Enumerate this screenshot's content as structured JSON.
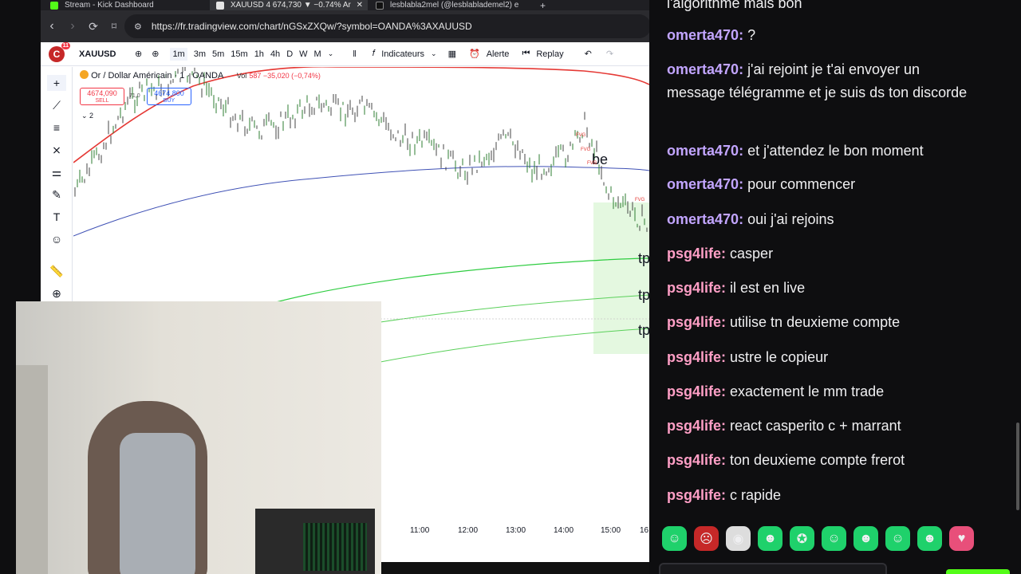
{
  "browser": {
    "tabs": [
      {
        "label": "Stream - Kick Dashboard",
        "icon": "kick-icon"
      },
      {
        "label": "XAUUSD 4 674,730 ▼ −0.74% Ar",
        "icon": "tradingview-icon",
        "close": "✕"
      },
      {
        "label": "lesblabla2mel (@lesblablademel2) e",
        "icon": "tiktok-icon"
      }
    ],
    "new_tab": "+",
    "url": "https://fr.tradingview.com/chart/nGSxZXQw/?symbol=OANDA%3AXAUUSD"
  },
  "tradingview": {
    "avatar_letter": "C",
    "notif_count": "11",
    "symbol": "XAUUSD",
    "timeframes": [
      "1m",
      "3m",
      "5m",
      "15m",
      "1h",
      "4h",
      "D",
      "W",
      "M"
    ],
    "indicators_label": "Indicateurs",
    "alert_label": "Alerte",
    "replay_label": "Replay",
    "legend_title": "Or / Dollar Américain · 1 · OANDA",
    "legend_vol": "Vol",
    "legend_change": "587  −35,020 (−0,74%)",
    "sell_price": "4674,090",
    "sell_label": "SELL",
    "mid_label": "71,0",
    "buy_price": "4674,800",
    "buy_label": "BUY",
    "indicators_count": "2",
    "annotations": [
      "be",
      "tp",
      "tp",
      "tp"
    ],
    "fvg_labels": [
      "FVG",
      "FVG",
      "FVG",
      "FVG"
    ],
    "time_labels": [
      "11:00",
      "12:00",
      "13:00",
      "14:00",
      "15:00",
      "16"
    ]
  },
  "chat": {
    "top_partial": "l'algorithme mais bon",
    "messages": [
      {
        "user": "omerta470",
        "text": "?"
      },
      {
        "user": "omerta470",
        "text": "j'ai rejoint je t'ai envoyer un message télégramme et je suis ds ton discorde"
      },
      {
        "user": "omerta470",
        "text": "et j'attendez le bon moment"
      },
      {
        "user": "omerta470",
        "text": "pour commencer"
      },
      {
        "user": "omerta470",
        "text": "oui j'ai rejoins"
      },
      {
        "user": "psg4life",
        "text": "casper"
      },
      {
        "user": "psg4life",
        "text": "il est en live"
      },
      {
        "user": "psg4life",
        "text": "utilise tn deuxieme compte"
      },
      {
        "user": "psg4life",
        "text": "ustre le copieur"
      },
      {
        "user": "psg4life",
        "text": "exactement le mm trade"
      },
      {
        "user": "psg4life",
        "text": "react casperito c + marrant"
      },
      {
        "user": "psg4life",
        "text": "ton deuxieme compte frerot"
      },
      {
        "user": "psg4life",
        "text": "c rapide"
      }
    ],
    "colors": {
      "omerta470": "#c2a5ff",
      "psg4life": "#ff9fc6",
      "kick_green": "#53fc18"
    }
  }
}
